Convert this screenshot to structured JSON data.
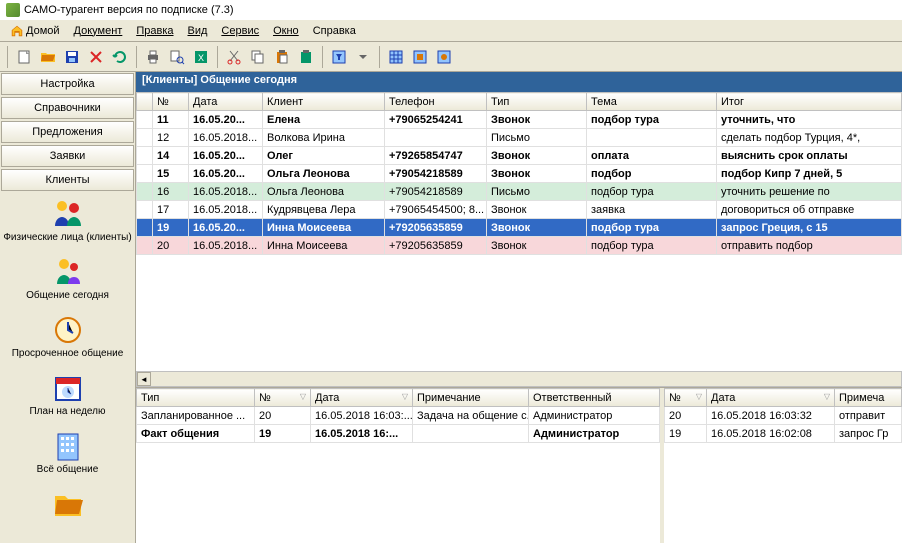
{
  "window": {
    "title": "САМО-турагент версия по подписке (7.3)"
  },
  "menu": {
    "home": "Домой",
    "items": [
      "Документ",
      "Правка",
      "Вид",
      "Сервис",
      "Окно",
      "Справка"
    ]
  },
  "sidebar": {
    "buttons": [
      "Настройка",
      "Справочники",
      "Предложения",
      "Заявки",
      "Клиенты"
    ],
    "nav": [
      {
        "label": "Физические лица (клиенты)"
      },
      {
        "label": "Общение сегодня"
      },
      {
        "label": "Просроченное общение"
      },
      {
        "label": "План на неделю"
      },
      {
        "label": "Всё общение"
      }
    ]
  },
  "tab": {
    "title": "[Клиенты] Общение сегодня"
  },
  "grid": {
    "headers": [
      "№",
      "Дата",
      "Клиент",
      "Телефон",
      "Тип",
      "Тема",
      "Итог"
    ],
    "rows": [
      {
        "cells": [
          "11",
          "16.05.20...",
          "Елена",
          "+79065254241",
          "Звонок",
          "подбор тура",
          "уточнить, что"
        ],
        "cls": "bold"
      },
      {
        "cells": [
          "12",
          "16.05.2018...",
          "Волкова Ирина",
          "",
          "Письмо",
          "",
          "сделать подбор Турция, 4*,"
        ],
        "cls": ""
      },
      {
        "cells": [
          "14",
          "16.05.20...",
          "Олег",
          "+79265854747",
          "Звонок",
          "оплата",
          "выяснить срок оплаты"
        ],
        "cls": "bold"
      },
      {
        "cells": [
          "15",
          "16.05.20...",
          "Ольга Леонова",
          "+79054218589",
          "Звонок",
          "подбор",
          "подбор Кипр 7 дней, 5"
        ],
        "cls": "bold"
      },
      {
        "cells": [
          "16",
          "16.05.2018...",
          "Ольга Леонова",
          "+79054218589",
          "Письмо",
          "подбор тура",
          "уточнить решение по"
        ],
        "cls": "green"
      },
      {
        "cells": [
          "17",
          "16.05.2018...",
          "Кудрявцева Лера",
          "+79065454500; 8...",
          "Звонок",
          "заявка",
          "договориться об отправке"
        ],
        "cls": ""
      },
      {
        "cells": [
          "19",
          "16.05.20...",
          "Инна Моисеева",
          "+79205635859",
          "Звонок",
          "подбор тура",
          "запрос Греция, с 15"
        ],
        "cls": "blue"
      },
      {
        "cells": [
          "20",
          "16.05.2018...",
          "Инна Моисеева",
          "+79205635859",
          "Звонок",
          "подбор тура",
          "отправить подбор"
        ],
        "cls": "pink"
      }
    ]
  },
  "bottomLeft": {
    "headers": [
      "Тип",
      "№",
      "Дата",
      "Примечание",
      "Ответственный"
    ],
    "rows": [
      {
        "cells": [
          "Запланированное ...",
          "20",
          "16.05.2018 16:03:...",
          "Задача на общение с...",
          "Администратор"
        ],
        "cls": ""
      },
      {
        "cells": [
          "Факт общения",
          "19",
          "16.05.2018 16:...",
          "",
          "Администратор"
        ],
        "cls": "bold"
      }
    ]
  },
  "bottomRight": {
    "headers": [
      "№",
      "Дата",
      "Примеча"
    ],
    "rows": [
      {
        "cells": [
          "20",
          "16.05.2018 16:03:32",
          "отправит"
        ],
        "cls": ""
      },
      {
        "cells": [
          "19",
          "16.05.2018 16:02:08",
          "запрос Гр"
        ],
        "cls": ""
      }
    ]
  }
}
